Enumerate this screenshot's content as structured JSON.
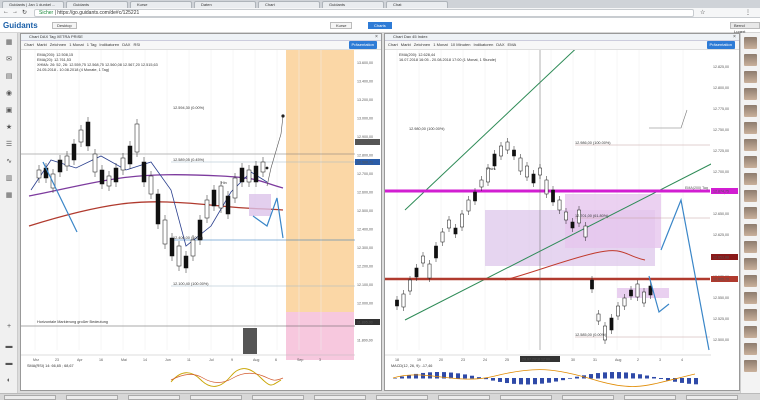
{
  "browser": {
    "tabs": [
      "Guidants | Jan 1 dunkel ...",
      "Guidants",
      "Kurse",
      "Daten",
      "Chart",
      "Guidants",
      "Chat"
    ],
    "url_prefix": "Sicher",
    "url": "https://go.guidants.com/de#c/125221",
    "user": "Bernd Lugert"
  },
  "app": {
    "logo": "Guidants",
    "header_tabs": [
      "Desktop"
    ],
    "center_tabs": [
      "Kurse",
      "Charts"
    ],
    "right_label": "Ihr Team"
  },
  "left_sidebar_icons": [
    "grid-icon",
    "comment-icon",
    "doc-icon",
    "eye-icon",
    "calendar-icon",
    "star-icon",
    "list-icon",
    "chart-icon",
    "table-icon",
    "grid2-icon",
    "plus-icon",
    "folder-icon",
    "folder-icon",
    "settings-icon"
  ],
  "left_window": {
    "title": "Chart DAX Tag XETRA PRISE",
    "toolbar": [
      "Chart",
      "Markt",
      "Zeichnen",
      "1 Monat",
      "1 Tag",
      "Indikatoren",
      "DAX",
      "RSI",
      "Präsentation"
    ],
    "legend": [
      "EMA(200): 12.508,15",
      "EMA(20): 12.761,53",
      "XHMA: 26: 52, 26: 12.559,75 12.568,75 12.560,08 12.567,20 12.515,63",
      "24.05.2018 - 10.08.2018 (4 Monate, 1 Tag)"
    ],
    "annotations": [
      "12.594,30 (0.00%)",
      "12.589,05 (0.45%)",
      "12.406,00 (100%)",
      "12.100,40 (100.00%)",
      "Horizontale Markierung großer Bedeutung",
      "Hin"
    ],
    "y_labels": [
      "13.600,00",
      "13.400,00",
      "13.200,00",
      "13.000,00",
      "12.900,00",
      "12.800,00",
      "12.700,00",
      "12.600,00",
      "12.500,00",
      "12.400,00",
      "12.300,00",
      "12.200,00",
      "12.100,00",
      "12.000,00",
      "11.900,00",
      "11.800,00"
    ],
    "price_tags": [
      "12.802,38",
      "12.588,71",
      "11.895,00"
    ],
    "x_labels": [
      "Mrz",
      "23",
      "Apr",
      "16",
      "Mai",
      "14",
      "Jun",
      "11",
      "Jul",
      "9",
      "Aug",
      "6",
      "Sep",
      "3"
    ],
    "indicator_legend": "SMA(RSI) 14: 66,65 ; 68,67",
    "close": "×"
  },
  "right_window": {
    "title": "Chart Dax 45 Index",
    "toolbar": [
      "Chart",
      "Markt",
      "Zeichnen",
      "1 Monat",
      "10 Minuten",
      "Indikatoren",
      "DAX",
      "EMA",
      "Präsentation"
    ],
    "legend": [
      "EMA(200): 12.628,44",
      "16.07.2018 16:05 - 20.08.2018 17:00 (1 Monat, 1 Stunde)"
    ],
    "annotations": [
      "12.986,00 (100.00%)",
      "12.701,00 (61.80%)",
      "12.585,00 (0.00%)",
      "Pairs",
      "12.980,00 (100.00%)"
    ],
    "y_labels": [
      "12.825,00",
      "12.800,00",
      "12.775,00",
      "12.750,00",
      "12.725,00",
      "12.700,00",
      "12.675,00",
      "12.650,00",
      "12.625,00",
      "12.600,00",
      "12.575,00",
      "12.550,00",
      "12.525,00",
      "12.500,00"
    ],
    "price_tags": [
      "12.874,75",
      "12.653,88",
      "12.605,79"
    ],
    "ema_tag": "EMA(200) Tag",
    "x_labels": [
      "18",
      "19",
      "20",
      "23",
      "24",
      "25",
      "26",
      "27",
      "30",
      "31",
      "Aug",
      "2",
      "3",
      "4"
    ],
    "crosshair_label": "20.07.2018 12:00",
    "indicator_legend": "MACD(12, 26, 9): -17,46",
    "close": "×"
  },
  "right_sidebar": {
    "avatars": 20
  },
  "taskbar": {
    "items": 12
  },
  "colors": {
    "magenta": "#d21ed2",
    "ema_red": "#b03a2e",
    "ema_purple": "#7d3b9e",
    "blue_arrow": "#3a86c8",
    "green": "#2e8b57",
    "orange_zone": "#fbd7a6",
    "pink_zone": "#f7c8de",
    "lilac": "#dcc3ea"
  }
}
